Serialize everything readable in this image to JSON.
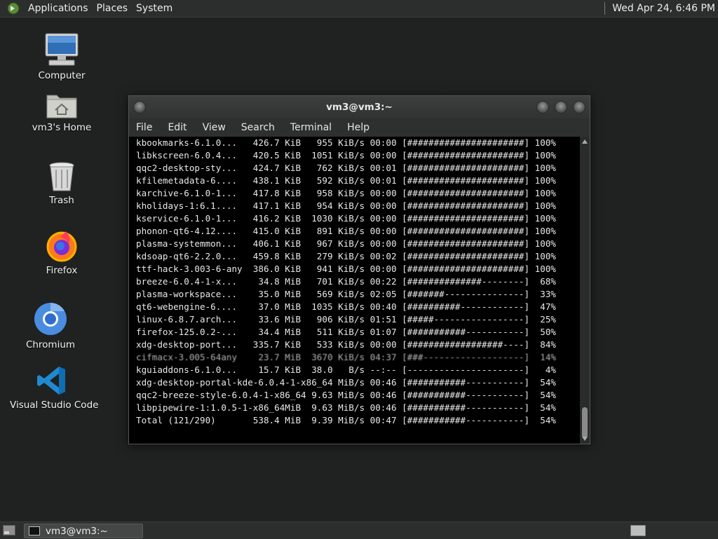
{
  "top_panel": {
    "menus": [
      "Applications",
      "Places",
      "System"
    ],
    "clock": "Wed Apr 24,  6:46 PM"
  },
  "desktop": {
    "icons": [
      {
        "label": "Computer",
        "icon": "computer-icon"
      },
      {
        "label": "vm3's Home",
        "icon": "home-folder-icon"
      },
      {
        "label": "Trash",
        "icon": "trash-icon"
      },
      {
        "label": "Firefox",
        "icon": "firefox-icon"
      },
      {
        "label": "Chromium",
        "icon": "chromium-icon"
      },
      {
        "label": "Visual Studio Code",
        "icon": "vscode-icon"
      }
    ]
  },
  "terminal": {
    "title": "vm3@vm3:~",
    "menu": [
      "File",
      "Edit",
      "View",
      "Search",
      "Terminal",
      "Help"
    ],
    "lines": [
      "kbookmarks-6.1.0...   426.7 KiB   955 KiB/s 00:00 [######################] 100%",
      "libkscreen-6.0.4...   420.5 KiB  1051 KiB/s 00:00 [######################] 100%",
      "qqc2-desktop-sty...   424.7 KiB   762 KiB/s 00:01 [######################] 100%",
      "kfilemetadata-6....   438.1 KiB   592 KiB/s 00:01 [######################] 100%",
      "karchive-6.1.0-1...   417.8 KiB   958 KiB/s 00:00 [######################] 100%",
      "kholidays-1:6.1....   417.1 KiB   954 KiB/s 00:00 [######################] 100%",
      "kservice-6.1.0-1...   416.2 KiB  1030 KiB/s 00:00 [######################] 100%",
      "phonon-qt6-4.12....   415.0 KiB   891 KiB/s 00:00 [######################] 100%",
      "plasma-systemmon...   406.1 KiB   967 KiB/s 00:00 [######################] 100%",
      "kdsoap-qt6-2.2.0...   459.8 KiB   279 KiB/s 00:02 [######################] 100%",
      "ttf-hack-3.003-6-any  386.0 KiB   941 KiB/s 00:00 [######################] 100%",
      "breeze-6.0.4-1-x...    34.8 MiB   701 KiB/s 00:22 [##############--------]  68%",
      "plasma-workspace...    35.0 MiB   569 KiB/s 02:05 [#######---------------]  33%",
      "qt6-webengine-6....    37.0 MiB  1035 KiB/s 00:40 [##########------------]  47%",
      "linux-6.8.7.arch...    33.6 MiB   906 KiB/s 01:51 [#####-----------------]  25%",
      "firefox-125.0.2-...    34.4 MiB   511 KiB/s 01:07 [###########-----------]  50%",
      "xdg-desktop-port...   335.7 KiB   533 KiB/s 00:00 [##################----]  84%",
      "cifmacx-3.005-64any    23.7 MiB  3670 KiB/s 04:37 [###-------------------]  14%",
      "kguiaddons-6.1.0...    15.7 KiB  38.0   B/s --:-- [----------------------]   4%",
      "xdg-desktop-portal-kde-6.0.4-1-x86_64 MiB/s 00:46 [###########-----------]  54%",
      "qqc2-breeze-style-6.0.4-1-x86_64 9.63 MiB/s 00:46 [###########-----------]  54%",
      "libpipewire-1:1.0.5-1-x86_64MiB  9.63 MiB/s 00:46 [###########-----------]  54%",
      "Total (121/290)       538.4 MiB  9.39 MiB/s 00:47 [###########-----------]  54%"
    ]
  },
  "taskbar": {
    "window_button": "vm3@vm3:~"
  },
  "colors": {
    "desktop_bg": "#1f2220",
    "panel_bg": "#2c2e2d",
    "terminal_bg": "#000000",
    "terminal_fg": "#e8e8e8"
  }
}
